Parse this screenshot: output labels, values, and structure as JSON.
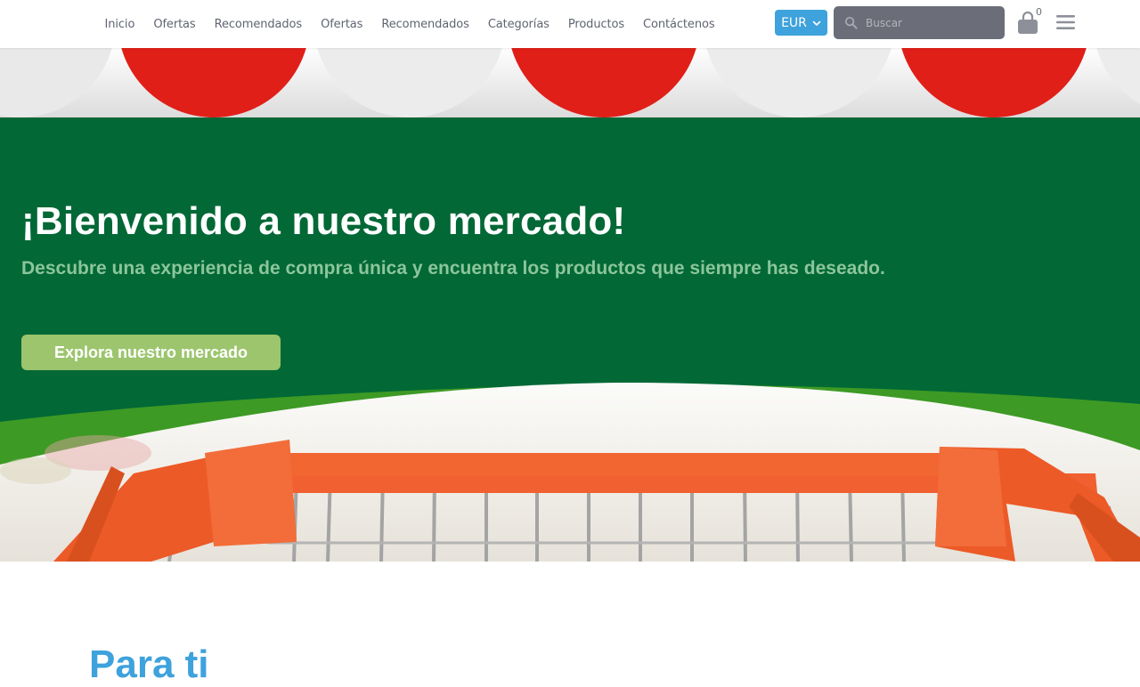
{
  "nav": {
    "items": [
      "Inicio",
      "Ofertas",
      "Recomendados",
      "Ofertas",
      "Recomendados",
      "Categorías",
      "Productos",
      "Contáctenos"
    ]
  },
  "header": {
    "currency": "EUR",
    "search_placeholder": "Buscar",
    "cart_count": "0"
  },
  "hero": {
    "title": "¡Bienvenido a nuestro mercado!",
    "subtitle": "Descubre una experiencia de compra única y encuentra los productos que siempre has deseado.",
    "cta": "Explora nuestro mercado"
  },
  "section": {
    "title": "Para ti"
  },
  "colors": {
    "brand_green": "#016836",
    "accent_blue": "#3ea2dc",
    "cta_green": "#9cc56d",
    "red": "#e01f18"
  },
  "icons": [
    "chevron-down-icon",
    "search-icon",
    "shopping-bag-icon",
    "hamburger-menu-icon"
  ]
}
